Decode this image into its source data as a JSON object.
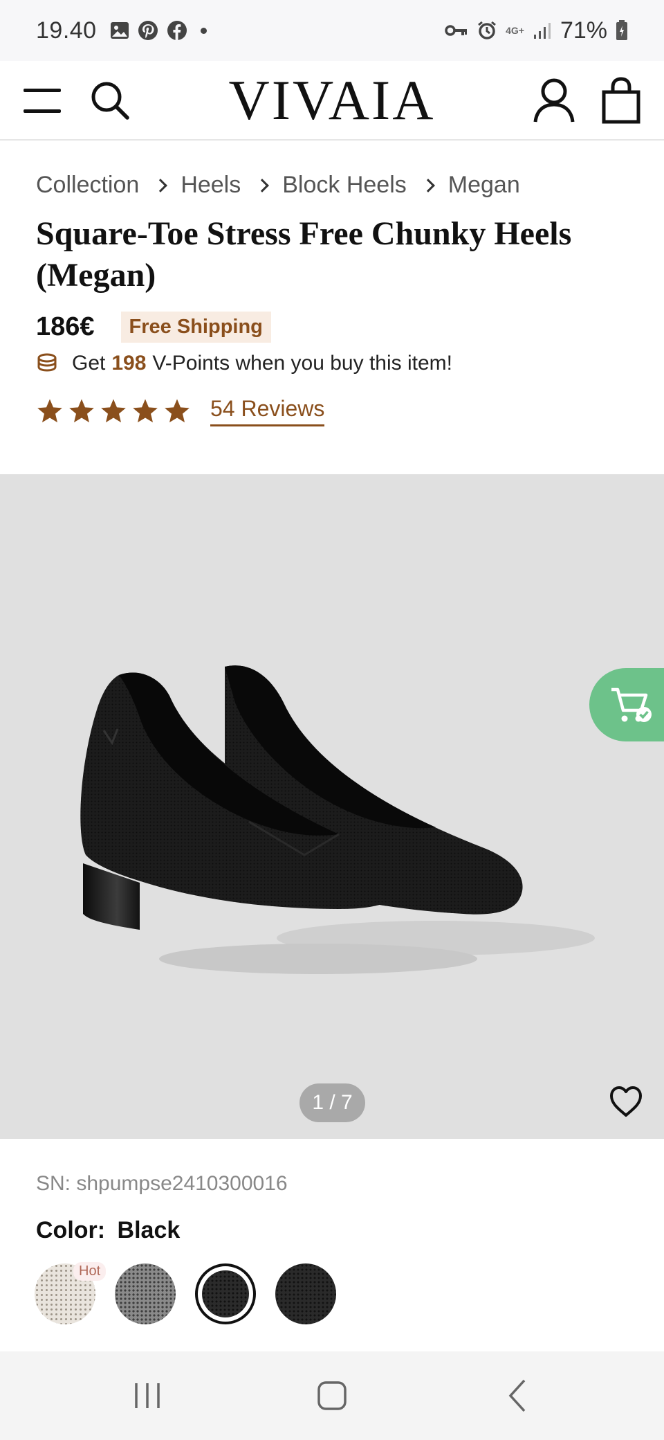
{
  "status_bar": {
    "time": "19.40",
    "network": "4G+",
    "battery": "71%"
  },
  "header": {
    "logo": "VIVAIA"
  },
  "breadcrumb": [
    "Collection",
    "Heels",
    "Block Heels",
    "Megan"
  ],
  "product": {
    "title": "Square-Toe Stress Free Chunky Heels (Megan)",
    "price": "186€",
    "shipping_badge": "Free Shipping",
    "points_prefix": "Get",
    "points_value": "198",
    "points_suffix": "V-Points when you buy this item!",
    "rating": 5,
    "reviews_label": "54 Reviews",
    "sn": "SN: shpumpse2410300016",
    "color_label": "Color:",
    "color_value": "Black"
  },
  "gallery": {
    "page_indicator": "1 / 7"
  },
  "swatches": [
    {
      "name": "cream",
      "badge": "Hot"
    },
    {
      "name": "gray"
    },
    {
      "name": "black",
      "selected": true
    },
    {
      "name": "dark"
    }
  ],
  "colors": {
    "accent_brown": "#8a4f1c",
    "badge_bg": "#f8ece2",
    "cart_green": "#6dc28a",
    "gallery_bg": "#e0e0e0"
  },
  "icons": {
    "header": [
      "menu-icon",
      "search-icon",
      "account-icon",
      "bag-icon"
    ],
    "gallery": [
      "cart-check-icon",
      "heart-icon"
    ],
    "nav": [
      "recent-apps-icon",
      "home-icon",
      "back-icon"
    ]
  }
}
